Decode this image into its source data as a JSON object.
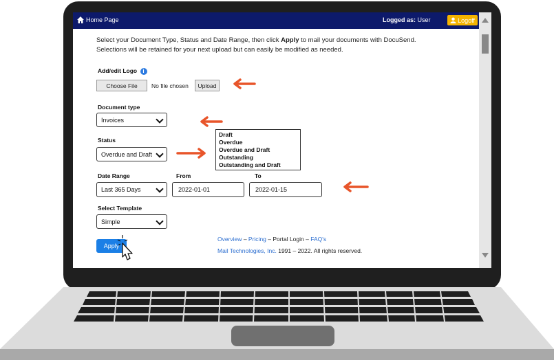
{
  "header": {
    "home_label": "Home Page",
    "logged_prefix": "Logged as:",
    "logged_user": "User",
    "logoff_label": "Logoff"
  },
  "intro": {
    "line1_pre": "Select your Document Type, Status and Date Range, then click ",
    "line1_bold": "Apply",
    "line1_post": " to mail your documents with DocuSend.",
    "line2": "Selections will be retained for your next upload but can easily be modified as needed."
  },
  "logo": {
    "label": "Add/edit Logo",
    "choose_file": "Choose File",
    "no_file": "No file chosen",
    "upload": "Upload"
  },
  "document_type": {
    "label": "Document type",
    "value": "Invoices"
  },
  "status": {
    "label": "Status",
    "value": "Overdue and Draft",
    "options": [
      "Draft",
      "Overdue",
      "Overdue and Draft",
      "Outstanding",
      "Outstanding and Draft"
    ]
  },
  "date_range": {
    "label": "Date Range",
    "value": "Last 365 Days",
    "from_label": "From",
    "from_value": "2022-01-01",
    "to_label": "To",
    "to_value": "2022-01-15"
  },
  "template": {
    "label": "Select Template",
    "value": "Simple"
  },
  "apply_label": "Apply",
  "footer": {
    "overview": "Overview",
    "pricing": "Pricing",
    "portal_login": "Portal Login",
    "faqs": "FAQ's",
    "dash": "–",
    "brand": "Mail Technologies, Inc.",
    "years": "1991 – 2022.",
    "rights": "All rights reserved."
  },
  "colors": {
    "header_bg": "#0d1a6b",
    "logoff_bg": "#f5b400",
    "apply_bg": "#1b7fe6",
    "arrow": "#e8552a",
    "link": "#2d6fd0"
  },
  "icons": [
    "home-icon",
    "user-icon",
    "info-icon",
    "chevron-down-icon",
    "arrow-left-icon",
    "arrow-right-icon",
    "pointer-cursor-icon"
  ]
}
